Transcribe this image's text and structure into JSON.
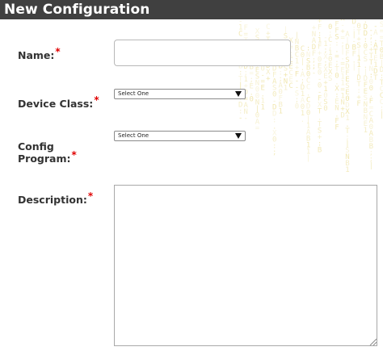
{
  "header": {
    "title": "New Configuration"
  },
  "form": {
    "name": {
      "label": "Name:",
      "required_mark": "*",
      "value": "",
      "placeholder": ""
    },
    "device_class": {
      "label": "Device Class:",
      "required_mark": "*",
      "selected": "Select One"
    },
    "config_program": {
      "label_line1": "Config",
      "label_line2": "Program:",
      "required_mark": "*",
      "selected": "Select One"
    },
    "description": {
      "label": "Description:",
      "required_mark": "*",
      "value": ""
    }
  },
  "colors": {
    "header_bg": "#404040",
    "header_text": "#ffffff",
    "required": "#e00000",
    "background_pattern": "#f3e9b3"
  },
  "icons": {
    "select_arrow": "dropdown-arrow-icon",
    "resize": "resize-grip-icon"
  }
}
